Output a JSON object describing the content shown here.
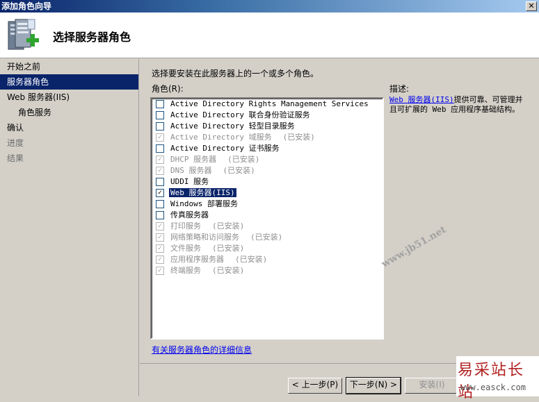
{
  "window": {
    "title": "添加角色向导",
    "close_glyph": "✕"
  },
  "header": {
    "title": "选择服务器角色",
    "icon": "server-add-icon"
  },
  "nav": {
    "items": [
      {
        "label": "开始之前",
        "state": "normal"
      },
      {
        "label": "服务器角色",
        "state": "active"
      },
      {
        "label": "Web 服务器(IIS)",
        "state": "normal"
      },
      {
        "label": "角色服务",
        "state": "normal"
      },
      {
        "label": "确认",
        "state": "normal"
      },
      {
        "label": "进度",
        "state": "disabled"
      },
      {
        "label": "结果",
        "state": "disabled"
      }
    ]
  },
  "main": {
    "instruction": "选择要安装在此服务器上的一个或多个角色。",
    "roles_label": "角色(R):",
    "description_label": "描述:",
    "description_link": "Web 服务器(IIS)",
    "description_text": "提供可靠、可管理并且可扩展的 Web 应用程序基础结构。",
    "more_info_link": "有关服务器角色的详细信息",
    "roles": [
      {
        "label": "Active Directory Rights Management Services",
        "checked": false,
        "disabled": false,
        "installed": ""
      },
      {
        "label": "Active Directory 联合身份验证服务",
        "checked": false,
        "disabled": false,
        "installed": ""
      },
      {
        "label": "Active Directory 轻型目录服务",
        "checked": false,
        "disabled": false,
        "installed": ""
      },
      {
        "label": "Active Directory 域服务",
        "checked": true,
        "disabled": true,
        "installed": "(已安装)"
      },
      {
        "label": "Active Directory 证书服务",
        "checked": false,
        "disabled": false,
        "installed": ""
      },
      {
        "label": "DHCP 服务器",
        "checked": true,
        "disabled": true,
        "installed": "(已安装)"
      },
      {
        "label": "DNS 服务器",
        "checked": true,
        "disabled": true,
        "installed": "(已安装)"
      },
      {
        "label": "UDDI 服务",
        "checked": false,
        "disabled": false,
        "installed": ""
      },
      {
        "label": "Web 服务器(IIS)",
        "checked": true,
        "disabled": false,
        "installed": "",
        "selected": true
      },
      {
        "label": "Windows 部署服务",
        "checked": false,
        "disabled": false,
        "installed": ""
      },
      {
        "label": "传真服务器",
        "checked": false,
        "disabled": false,
        "installed": ""
      },
      {
        "label": "打印服务",
        "checked": true,
        "disabled": true,
        "installed": "(已安装)"
      },
      {
        "label": "网络策略和访问服务",
        "checked": true,
        "disabled": true,
        "installed": "(已安装)"
      },
      {
        "label": "文件服务",
        "checked": true,
        "disabled": true,
        "installed": "(已安装)"
      },
      {
        "label": "应用程序服务器",
        "checked": true,
        "disabled": true,
        "installed": "(已安装)"
      },
      {
        "label": "终端服务",
        "checked": true,
        "disabled": true,
        "installed": "(已安装)"
      }
    ]
  },
  "buttons": {
    "previous": "< 上一步(P)",
    "next": "下一步(N) >",
    "install": "安装(I)"
  },
  "watermark": "www.jb51.net",
  "stamp": {
    "line1": "易采站长站",
    "line2": "www.easck.com"
  }
}
